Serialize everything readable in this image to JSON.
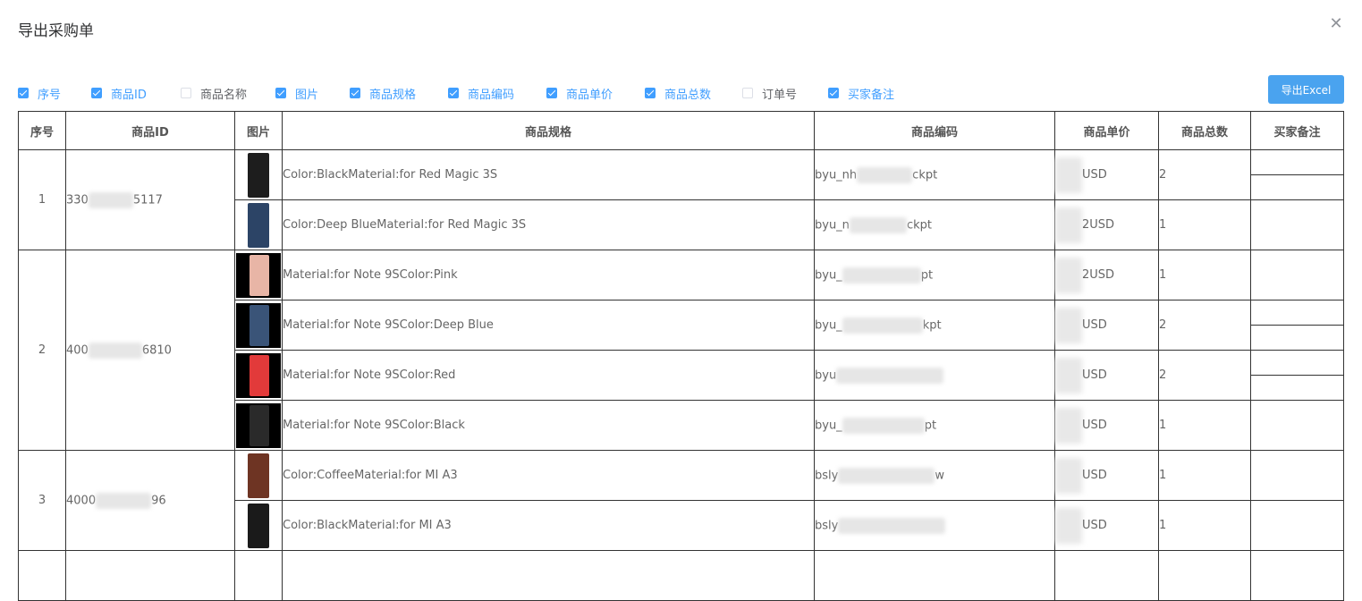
{
  "dialog": {
    "title": "导出采购单",
    "close_icon": "close-icon"
  },
  "checkboxes": [
    {
      "label": "序号",
      "checked": true
    },
    {
      "label": "商品ID",
      "checked": true
    },
    {
      "label": "商品名称",
      "checked": false
    },
    {
      "label": "图片",
      "checked": true
    },
    {
      "label": "商品规格",
      "checked": true
    },
    {
      "label": "商品编码",
      "checked": true
    },
    {
      "label": "商品单价",
      "checked": true
    },
    {
      "label": "商品总数",
      "checked": true
    },
    {
      "label": "订单号",
      "checked": false
    },
    {
      "label": "买家备注",
      "checked": true
    }
  ],
  "export_button": "导出Excel",
  "colors": {
    "accent": "#409eff",
    "button": "#4aa3ef"
  },
  "table": {
    "headers": [
      "序号",
      "商品ID",
      "图片",
      "商品规格",
      "商品编码",
      "商品单价",
      "商品总数",
      "买家备注"
    ],
    "groups": [
      {
        "index": "1",
        "product_id": "330",
        "product_id_tail": "5117",
        "rows": [
          {
            "spec": "Color:BlackMaterial:for Red Magic 3S",
            "code": "byu_nh",
            "code_tail": "ckpt",
            "price": "USD",
            "qty": "2",
            "thumb": "#1d1d1d"
          },
          {
            "spec": "Color:Deep BlueMaterial:for Red Magic 3S",
            "code": "byu_n",
            "code_tail": "ckpt",
            "price": "2USD",
            "qty": "1",
            "thumb": "#2c4466"
          }
        ]
      },
      {
        "index": "2",
        "product_id": "400",
        "product_id_tail": "6810",
        "rows": [
          {
            "spec": "Material:for Note 9SColor:Pink",
            "code": "byu_",
            "code_tail": "pt",
            "price": "2USD",
            "qty": "1",
            "thumb": "#e8b5a6"
          },
          {
            "spec": "Material:for Note 9SColor:Deep Blue",
            "code": "byu_",
            "code_tail": "kpt",
            "price": "USD",
            "qty": "2",
            "thumb": "#3a5478"
          },
          {
            "spec": "Material:for Note 9SColor:Red",
            "code": "byu",
            "code_tail": "",
            "price": "USD",
            "qty": "2",
            "thumb": "#e23a3a"
          },
          {
            "spec": "Material:for Note 9SColor:Black",
            "code": "byu_",
            "code_tail": "pt",
            "price": "USD",
            "qty": "1",
            "thumb": "#2a2a2a"
          }
        ]
      },
      {
        "index": "3",
        "product_id": "4000",
        "product_id_tail": "96",
        "rows": [
          {
            "spec": "Color:CoffeeMaterial:for MI A3",
            "code": "bsly",
            "code_tail": "w",
            "price": "USD",
            "qty": "1",
            "thumb": "#6e3423"
          },
          {
            "spec": "Color:BlackMaterial:for MI A3",
            "code": "bsly",
            "code_tail": "",
            "price": "USD",
            "qty": "1",
            "thumb": "#1a1a1a"
          }
        ]
      }
    ]
  }
}
